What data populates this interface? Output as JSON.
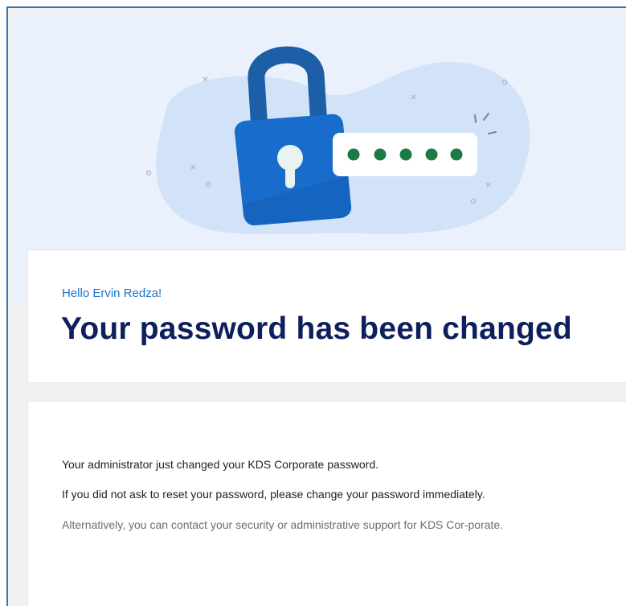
{
  "email": {
    "greeting": "Hello Ervin Redza!",
    "title": "Your password has been changed",
    "paragraphs": [
      "Your administrator just changed your KDS Corporate password.",
      "If you did not ask to reset your password, please change your password immediately.",
      "Alternatively, you can contact your security or administrative support for KDS Cor-porate."
    ]
  },
  "illustration": {
    "icons": [
      "padlock-icon",
      "password-dots-icon"
    ],
    "password_dot_count": 5
  },
  "colors": {
    "frame_border": "#2f78b8",
    "hero_background": "#eaf1fc",
    "blob": "#d2e2f8",
    "lock_shackle": "#1d5fa6",
    "lock_body": "#1565c0",
    "dot_green": "#1b7a45",
    "greeting": "#1a73c8",
    "headline": "#0d1f5c"
  }
}
